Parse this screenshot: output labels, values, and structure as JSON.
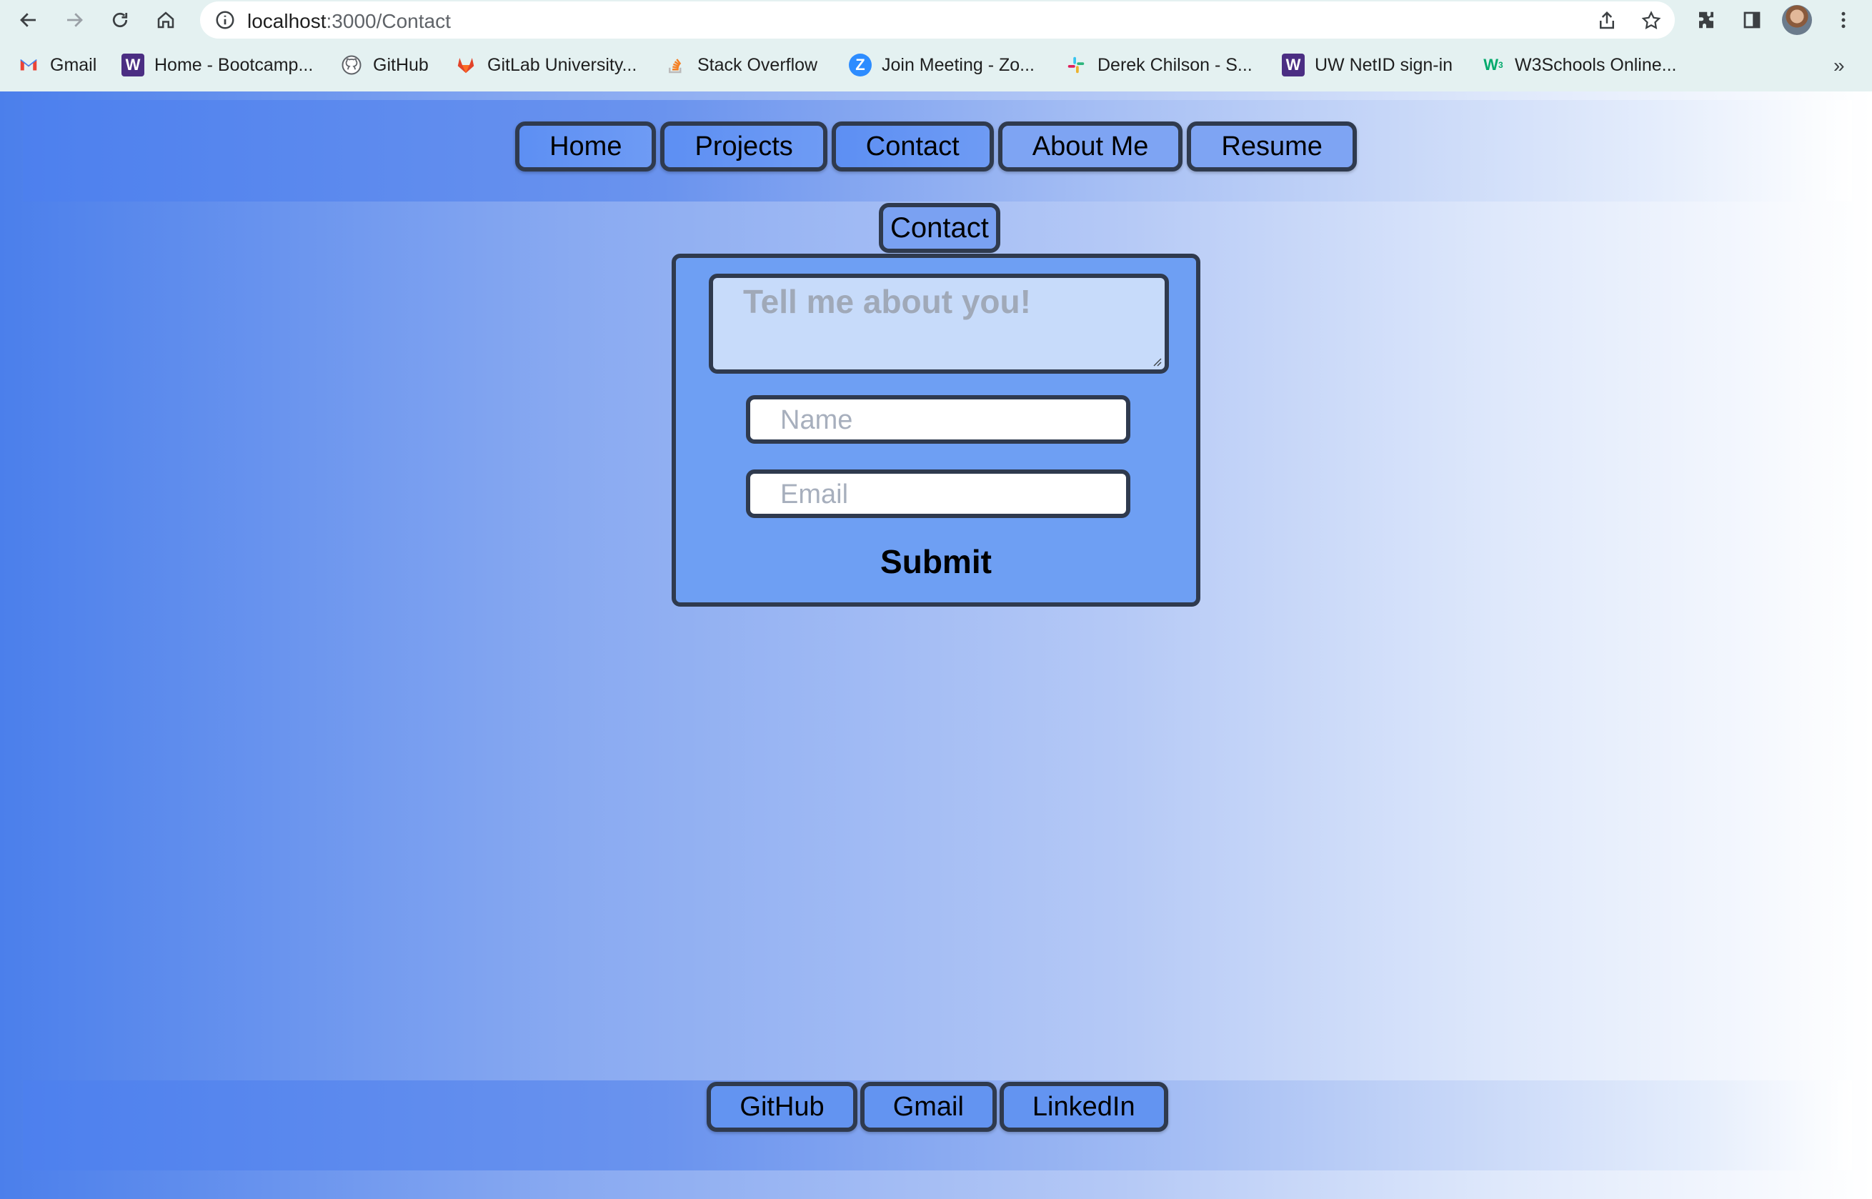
{
  "browser": {
    "url_host": "localhost",
    "url_path": ":3000/Contact",
    "bookmarks": [
      {
        "label": "Gmail",
        "icon": "gmail-icon"
      },
      {
        "label": "Home - Bootcamp...",
        "icon": "uw-w-icon"
      },
      {
        "label": "GitHub",
        "icon": "github-icon"
      },
      {
        "label": "GitLab University...",
        "icon": "gitlab-icon"
      },
      {
        "label": "Stack Overflow",
        "icon": "stackoverflow-icon"
      },
      {
        "label": "Join Meeting - Zo...",
        "icon": "zoom-icon"
      },
      {
        "label": "Derek Chilson - S...",
        "icon": "slack-icon"
      },
      {
        "label": "UW NetID sign-in",
        "icon": "uw-w-icon"
      },
      {
        "label": "W3Schools Online...",
        "icon": "w3schools-icon"
      }
    ],
    "more_bookmarks": "»"
  },
  "nav": {
    "items": [
      "Home",
      "Projects",
      "Contact",
      "About Me",
      "Resume"
    ]
  },
  "contact": {
    "heading": "Contact",
    "message_placeholder": "Tell me about you!",
    "name_placeholder": "Name",
    "email_placeholder": "Email",
    "submit_label": "Submit"
  },
  "footer": {
    "links": [
      "GitHub",
      "Gmail",
      "LinkedIn"
    ]
  },
  "colors": {
    "accent_border": "#2f3a4e",
    "button_blue": "#5d8ff3",
    "gradient_start": "#4b7feb",
    "gradient_end": "#ffffff"
  }
}
